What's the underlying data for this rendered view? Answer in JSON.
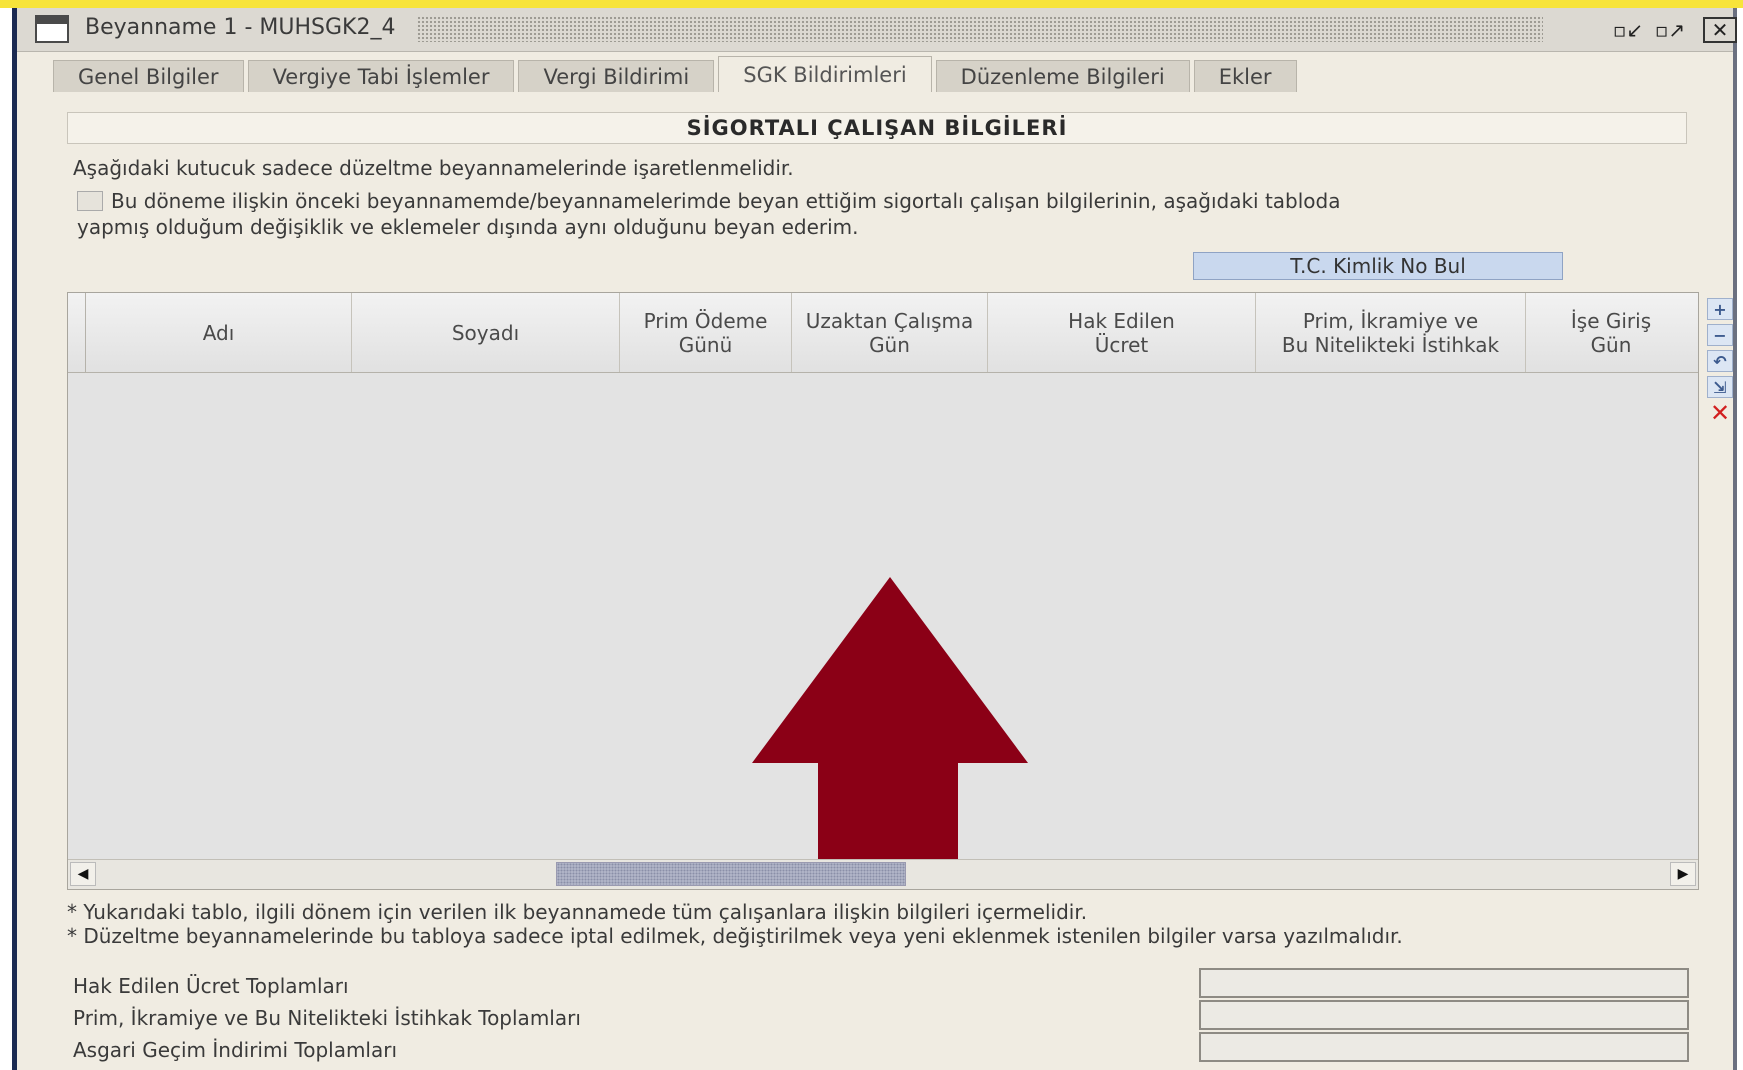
{
  "window": {
    "title": "Beyanname 1 - MUHSGK2_4",
    "controls": {
      "minimize_icon": "▫↙",
      "restore_icon": "▫↗",
      "close_icon": "✕"
    }
  },
  "tabs": [
    {
      "label": "Genel Bilgiler",
      "active": false
    },
    {
      "label": "Vergiye Tabi İşlemler",
      "active": false
    },
    {
      "label": "Vergi Bildirimi",
      "active": false
    },
    {
      "label": "SGK Bildirimleri",
      "active": true
    },
    {
      "label": "Düzenleme Bilgileri",
      "active": false
    },
    {
      "label": "Ekler",
      "active": false
    }
  ],
  "section": {
    "title": "SİGORTALI ÇALIŞAN BİLGİLERİ",
    "note": "Aşağıdaki kutucuk sadece düzeltme beyannamelerinde işaretlenmelidir.",
    "checkbox_text_line1": "Bu döneme ilişkin önceki beyannamemde/beyannamelerimde beyan ettiğim sigortalı çalışan bilgilerinin, aşağıdaki tabloda",
    "checkbox_text_line2": "yapmış olduğum değişiklik ve eklemeler dışında aynı olduğunu beyan ederim.",
    "tc_button_label": "T.C. Kimlik No Bul"
  },
  "table": {
    "columns": [
      "Adı",
      "Soyadı",
      "Prim Ödeme\nGünü",
      "Uzaktan Çalışma\nGün",
      "Hak Edilen\nÜcret",
      "Prim, İkramiye ve\nBu Nitelikteki İstihkak",
      "İşe Giriş\nGün"
    ],
    "rows": []
  },
  "side_tools": {
    "add": "+",
    "remove": "−",
    "undo": "↶",
    "export": "⇲",
    "delete": "✕"
  },
  "footnotes": {
    "line1": "* Yukarıdaki tablo, ilgili dönem için verilen ilk beyannamede tüm çalışanlara ilişkin bilgileri içermelidir.",
    "line2": "* Düzeltme beyannamelerinde bu tabloya sadece iptal edilmek, değiştirilmek veya yeni eklenmek istenilen bilgiler varsa yazılmalıdır."
  },
  "totals": {
    "hak_edilen": {
      "label": "Hak Edilen Ücret Toplamları",
      "value": ""
    },
    "prim_ikramiye": {
      "label": "Prim, İkramiye ve Bu Nitelikteki İstihkak Toplamları",
      "value": ""
    },
    "asgari_gecim": {
      "label": "Asgari Geçim İndirimi Toplamları",
      "value": ""
    }
  },
  "colors": {
    "arrow": "#8b0016",
    "active_button": "#c9d8ee",
    "window_frame": "#1b2a52"
  }
}
